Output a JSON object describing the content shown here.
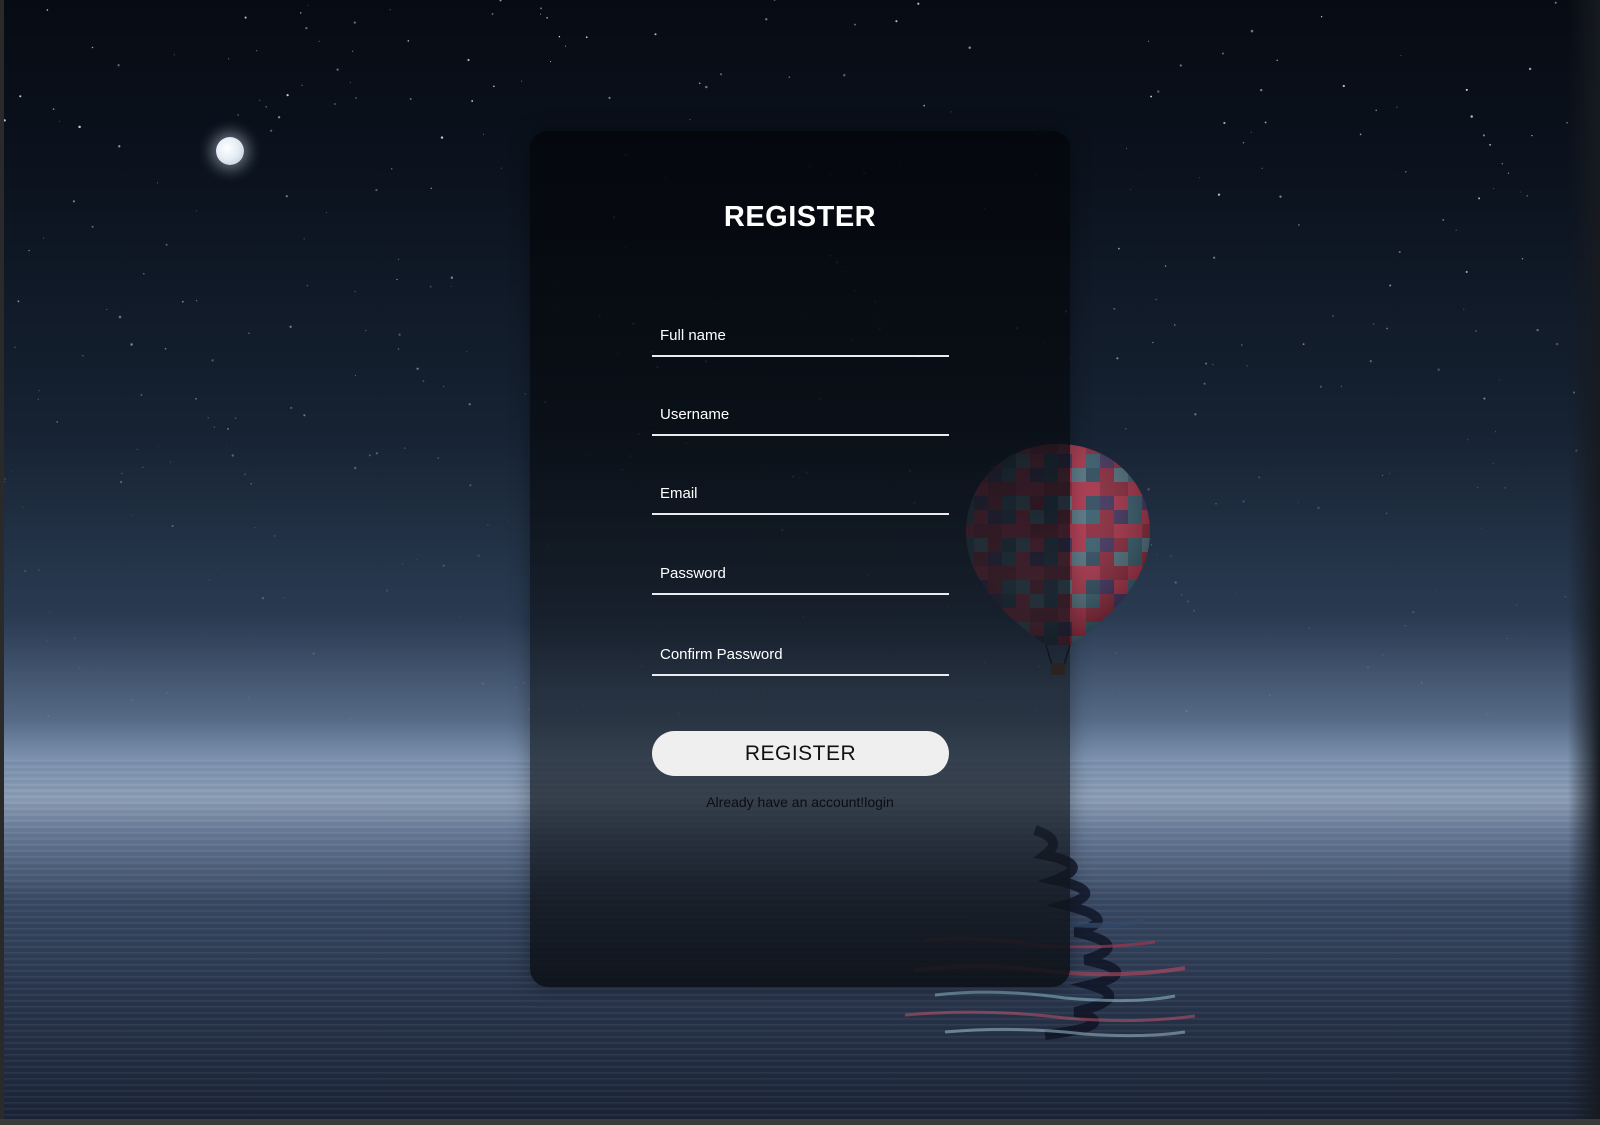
{
  "form": {
    "title": "REGISTER",
    "fields": [
      {
        "name": "full-name",
        "placeholder": "Full name",
        "value": ""
      },
      {
        "name": "username",
        "placeholder": "Username",
        "value": ""
      },
      {
        "name": "email",
        "placeholder": "Email",
        "value": ""
      },
      {
        "name": "password",
        "placeholder": "Password",
        "value": ""
      },
      {
        "name": "confirm-password",
        "placeholder": "Confirm Password",
        "value": ""
      }
    ],
    "submit_label": "REGISTER",
    "footer_text": "Already have an account!",
    "login_link": "login"
  },
  "theme": {
    "card_color": "#0a0e14",
    "button_color": "#efefef",
    "input_line_color": "#e8ecf0",
    "text_color": "#ffffff"
  },
  "icons": [
    "moon-image",
    "hot-air-balloon-image"
  ]
}
